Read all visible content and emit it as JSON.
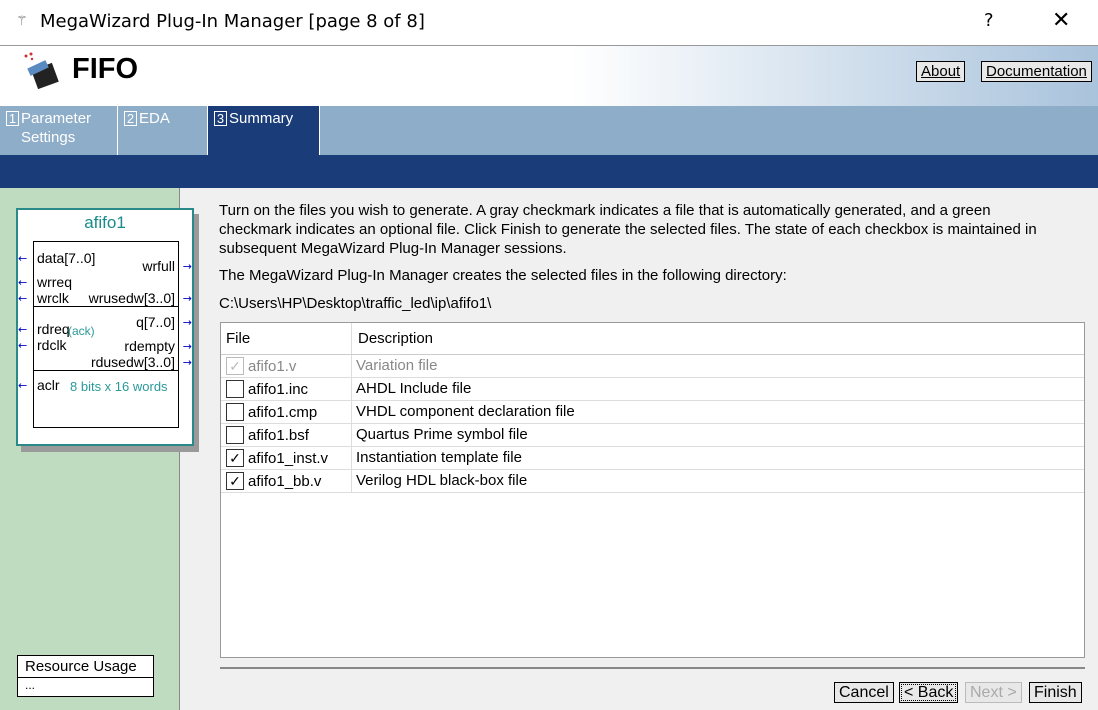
{
  "window": {
    "title": "MegaWizard Plug-In Manager [page 8 of 8]",
    "help": "?",
    "close": "✕"
  },
  "header": {
    "title": "FIFO",
    "about": "About",
    "documentation": "Documentation"
  },
  "tabs": [
    {
      "num": "1",
      "label": "Parameter Settings"
    },
    {
      "num": "2",
      "label": "EDA"
    },
    {
      "num": "3",
      "label": "Summary",
      "active": true
    }
  ],
  "symbol": {
    "name": "afifo1",
    "inputs": [
      "data[7..0]",
      "wrreq",
      "wrclk",
      "rdreq",
      "rdclk",
      "aclr"
    ],
    "outputs": [
      "wrfull",
      "wrusedw[3..0]",
      "q[7..0]",
      "rdempty",
      "rdusedw[3..0]"
    ],
    "ack": "(ack)",
    "info": "8 bits x 16 words"
  },
  "resource": {
    "title": "Resource Usage",
    "value": "..."
  },
  "main": {
    "intro_lines": [
      "Turn on the files you wish to generate. A gray checkmark indicates a file that is automatically generated, and a green",
      "checkmark indicates an optional file. Click Finish to generate the selected files. The state of each checkbox is maintained in",
      "subsequent MegaWizard Plug-In Manager sessions."
    ],
    "dir_label": "The MegaWizard Plug-In Manager creates the selected files in the following directory:",
    "directory": "C:\\Users\\HP\\Desktop\\traffic_led\\ip\\afifo1\\",
    "table": {
      "headers": [
        "File",
        "Description"
      ],
      "rows": [
        {
          "file": "afifo1.v",
          "desc": "Variation file",
          "checked": true,
          "disabled": true
        },
        {
          "file": "afifo1.inc",
          "desc": "AHDL Include file",
          "checked": false
        },
        {
          "file": "afifo1.cmp",
          "desc": "VHDL component declaration file",
          "checked": false
        },
        {
          "file": "afifo1.bsf",
          "desc": "Quartus Prime symbol file",
          "checked": false
        },
        {
          "file": "afifo1_inst.v",
          "desc": "Instantiation template file",
          "checked": true
        },
        {
          "file": "afifo1_bb.v",
          "desc": "Verilog HDL black-box file",
          "checked": true
        }
      ]
    }
  },
  "buttons": {
    "cancel": "Cancel",
    "back": "< Back",
    "next": "Next >",
    "finish": "Finish"
  }
}
